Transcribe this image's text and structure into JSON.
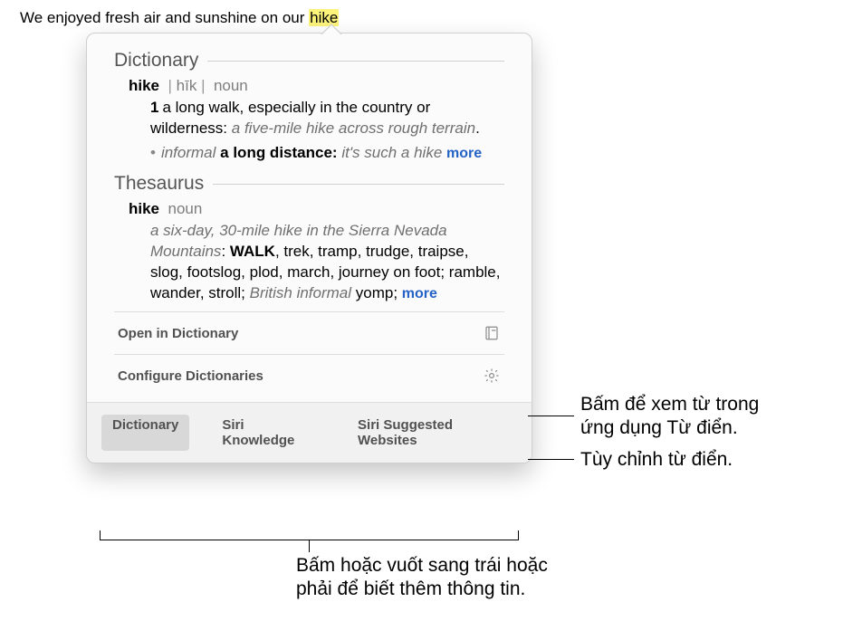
{
  "sentence": {
    "prefix": "We enjoyed fresh air and sunshine on our ",
    "highlighted": "hike"
  },
  "popover": {
    "dictionary": {
      "title": "Dictionary",
      "word": "hike",
      "pronunciation": "hīk",
      "pos": "noun",
      "sense_num": "1",
      "definition": "a long walk, especially in the country or wilderness:",
      "example": "a five-mile hike across rough terrain",
      "sub_label": "informal",
      "sub_definition": "a long distance:",
      "sub_example": "it's such a hike",
      "more": "more"
    },
    "thesaurus": {
      "title": "Thesaurus",
      "word": "hike",
      "pos": "noun",
      "example": "a six-day, 30-mile hike in the Sierra Nevada Mountains",
      "primary": "WALK",
      "synonyms": ", trek, tramp, trudge, traipse, slog, footslog, plod, march, journey on foot; ramble, wander, stroll; ",
      "label": "British informal",
      "tail": " yomp; ",
      "more": "more"
    },
    "open_label": "Open in Dictionary",
    "configure_label": "Configure Dictionaries",
    "tabs": {
      "dictionary": "Dictionary",
      "siri_knowledge": "Siri Knowledge",
      "siri_websites": "Siri Suggested Websites"
    }
  },
  "callouts": {
    "open": "Bấm để xem từ trong\nứng dụng Từ điển.",
    "configure": "Tùy chỉnh từ điển.",
    "tabs": "Bấm hoặc vuốt sang trái hoặc\nphải để biết thêm thông tin."
  }
}
